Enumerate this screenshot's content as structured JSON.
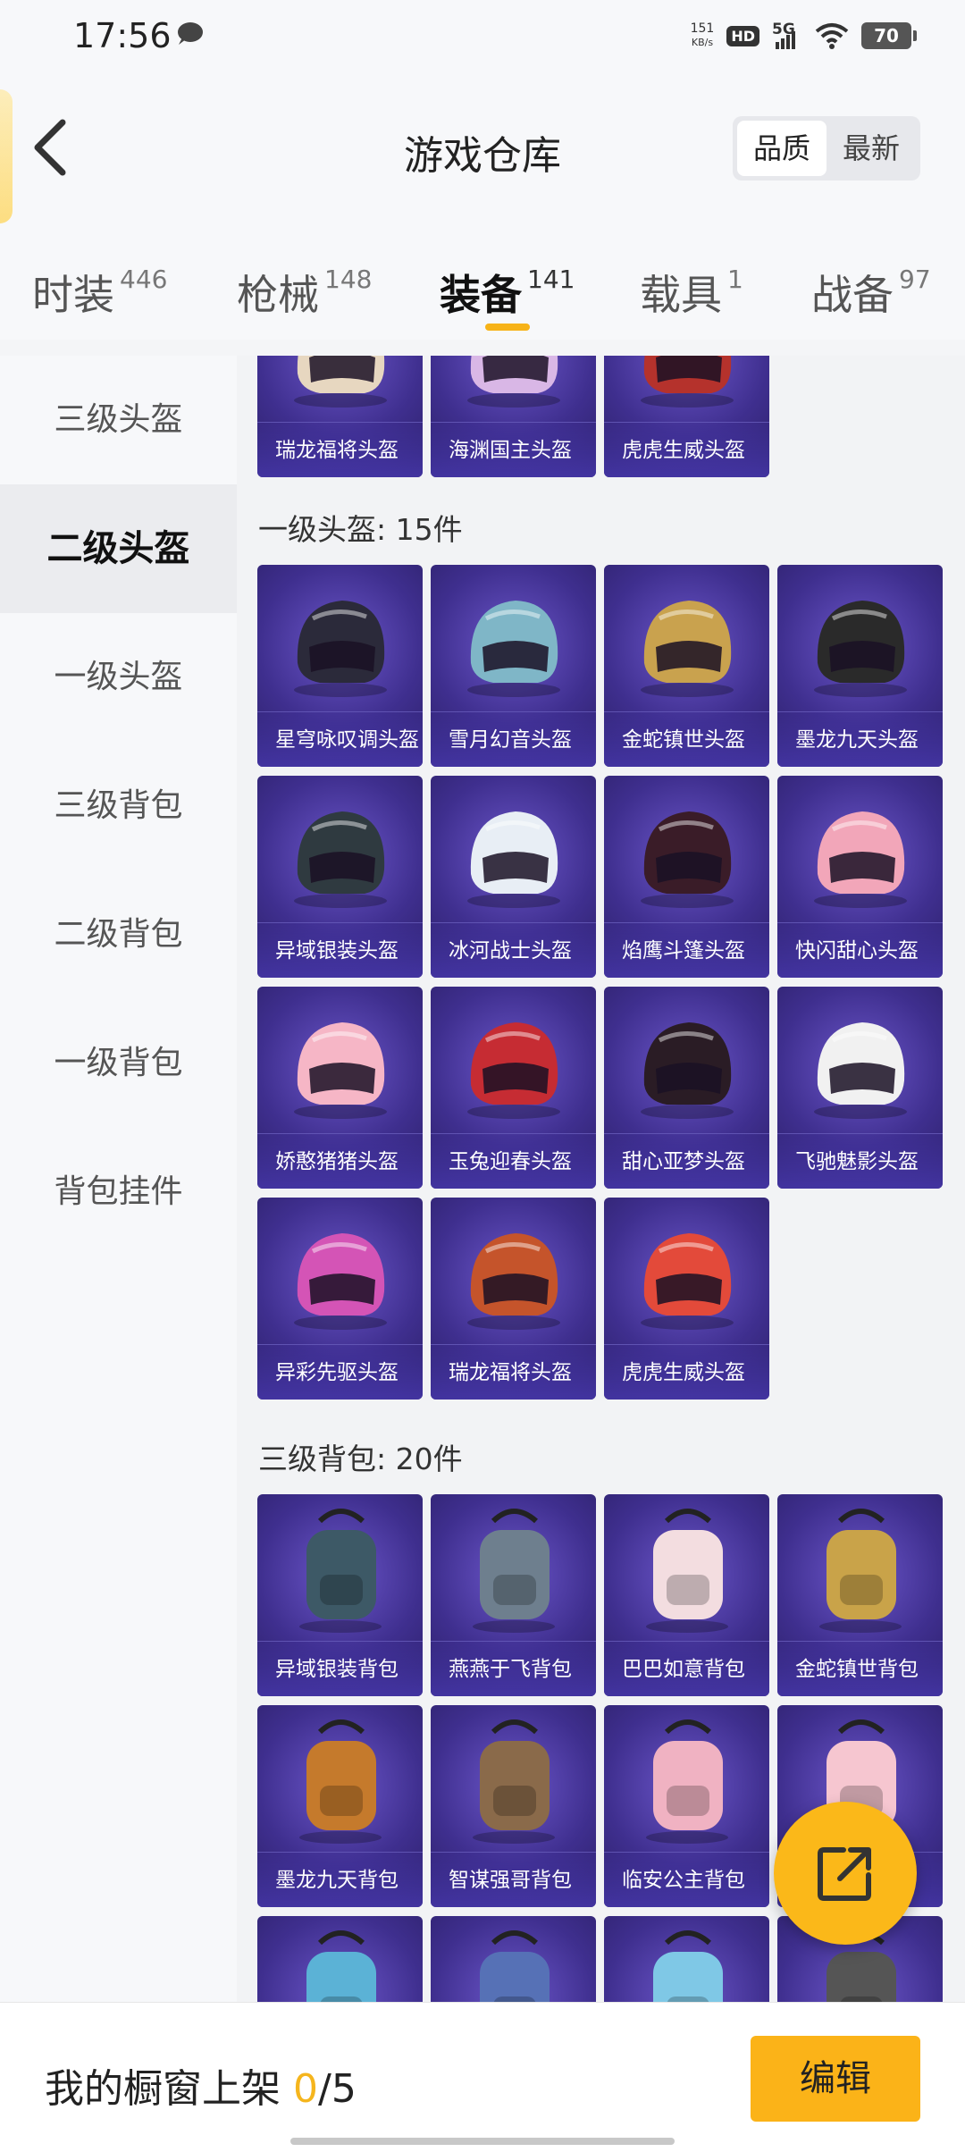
{
  "status_bar": {
    "time": "17:56",
    "net_speed_value": "151",
    "net_speed_unit": "KB/s",
    "hd": "HD",
    "signal": "5G",
    "battery": "70"
  },
  "header": {
    "title": "游戏仓库",
    "sort_options": [
      "品质",
      "最新"
    ],
    "sort_active": "品质"
  },
  "tabs": [
    {
      "label": "时装",
      "count": "446"
    },
    {
      "label": "枪械",
      "count": "148"
    },
    {
      "label": "装备",
      "count": "141"
    },
    {
      "label": "载具",
      "count": "1"
    },
    {
      "label": "战备",
      "count": "97"
    }
  ],
  "active_tab": "装备",
  "sidebar": {
    "items": [
      "三级头盔",
      "二级头盔",
      "一级头盔",
      "三级背包",
      "二级背包",
      "一级背包",
      "背包挂件"
    ],
    "active": "二级头盔"
  },
  "content": {
    "top_partial_items": [
      "瑞龙福将头盔",
      "海渊国主头盔",
      "虎虎生威头盔"
    ],
    "sections": [
      {
        "title": "一级头盔: 15件",
        "items": [
          "星穹咏叹调头盔",
          "雪月幻音头盔",
          "金蛇镇世头盔",
          "墨龙九天头盔",
          "异域银装头盔",
          "冰河战士头盔",
          "焰鹰斗篷头盔",
          "快闪甜心头盔",
          "娇憨猪猪头盔",
          "玉兔迎春头盔",
          "甜心亚梦头盔",
          "飞驰魅影头盔",
          "异彩先驱头盔",
          "瑞龙福将头盔",
          "虎虎生威头盔"
        ]
      },
      {
        "title": "三级背包: 20件",
        "items": [
          "异域银装背包",
          "燕燕于飞背包",
          "巴巴如意背包",
          "金蛇镇世背包",
          "墨龙九天背包",
          "智谋强哥背包",
          "临安公主背包",
          "",
          "",
          "",
          "",
          ""
        ]
      }
    ]
  },
  "bottom_bar": {
    "showcase_label": "我的橱窗上架",
    "showcase_current": "0",
    "showcase_total": "/5",
    "edit_label": "编辑"
  },
  "colors": {
    "accent": "#fbb318",
    "item_bg": "#3f2f8f"
  },
  "icons": {
    "back": "chevron-left-icon",
    "fab": "share-icon",
    "chat": "message-icon"
  }
}
